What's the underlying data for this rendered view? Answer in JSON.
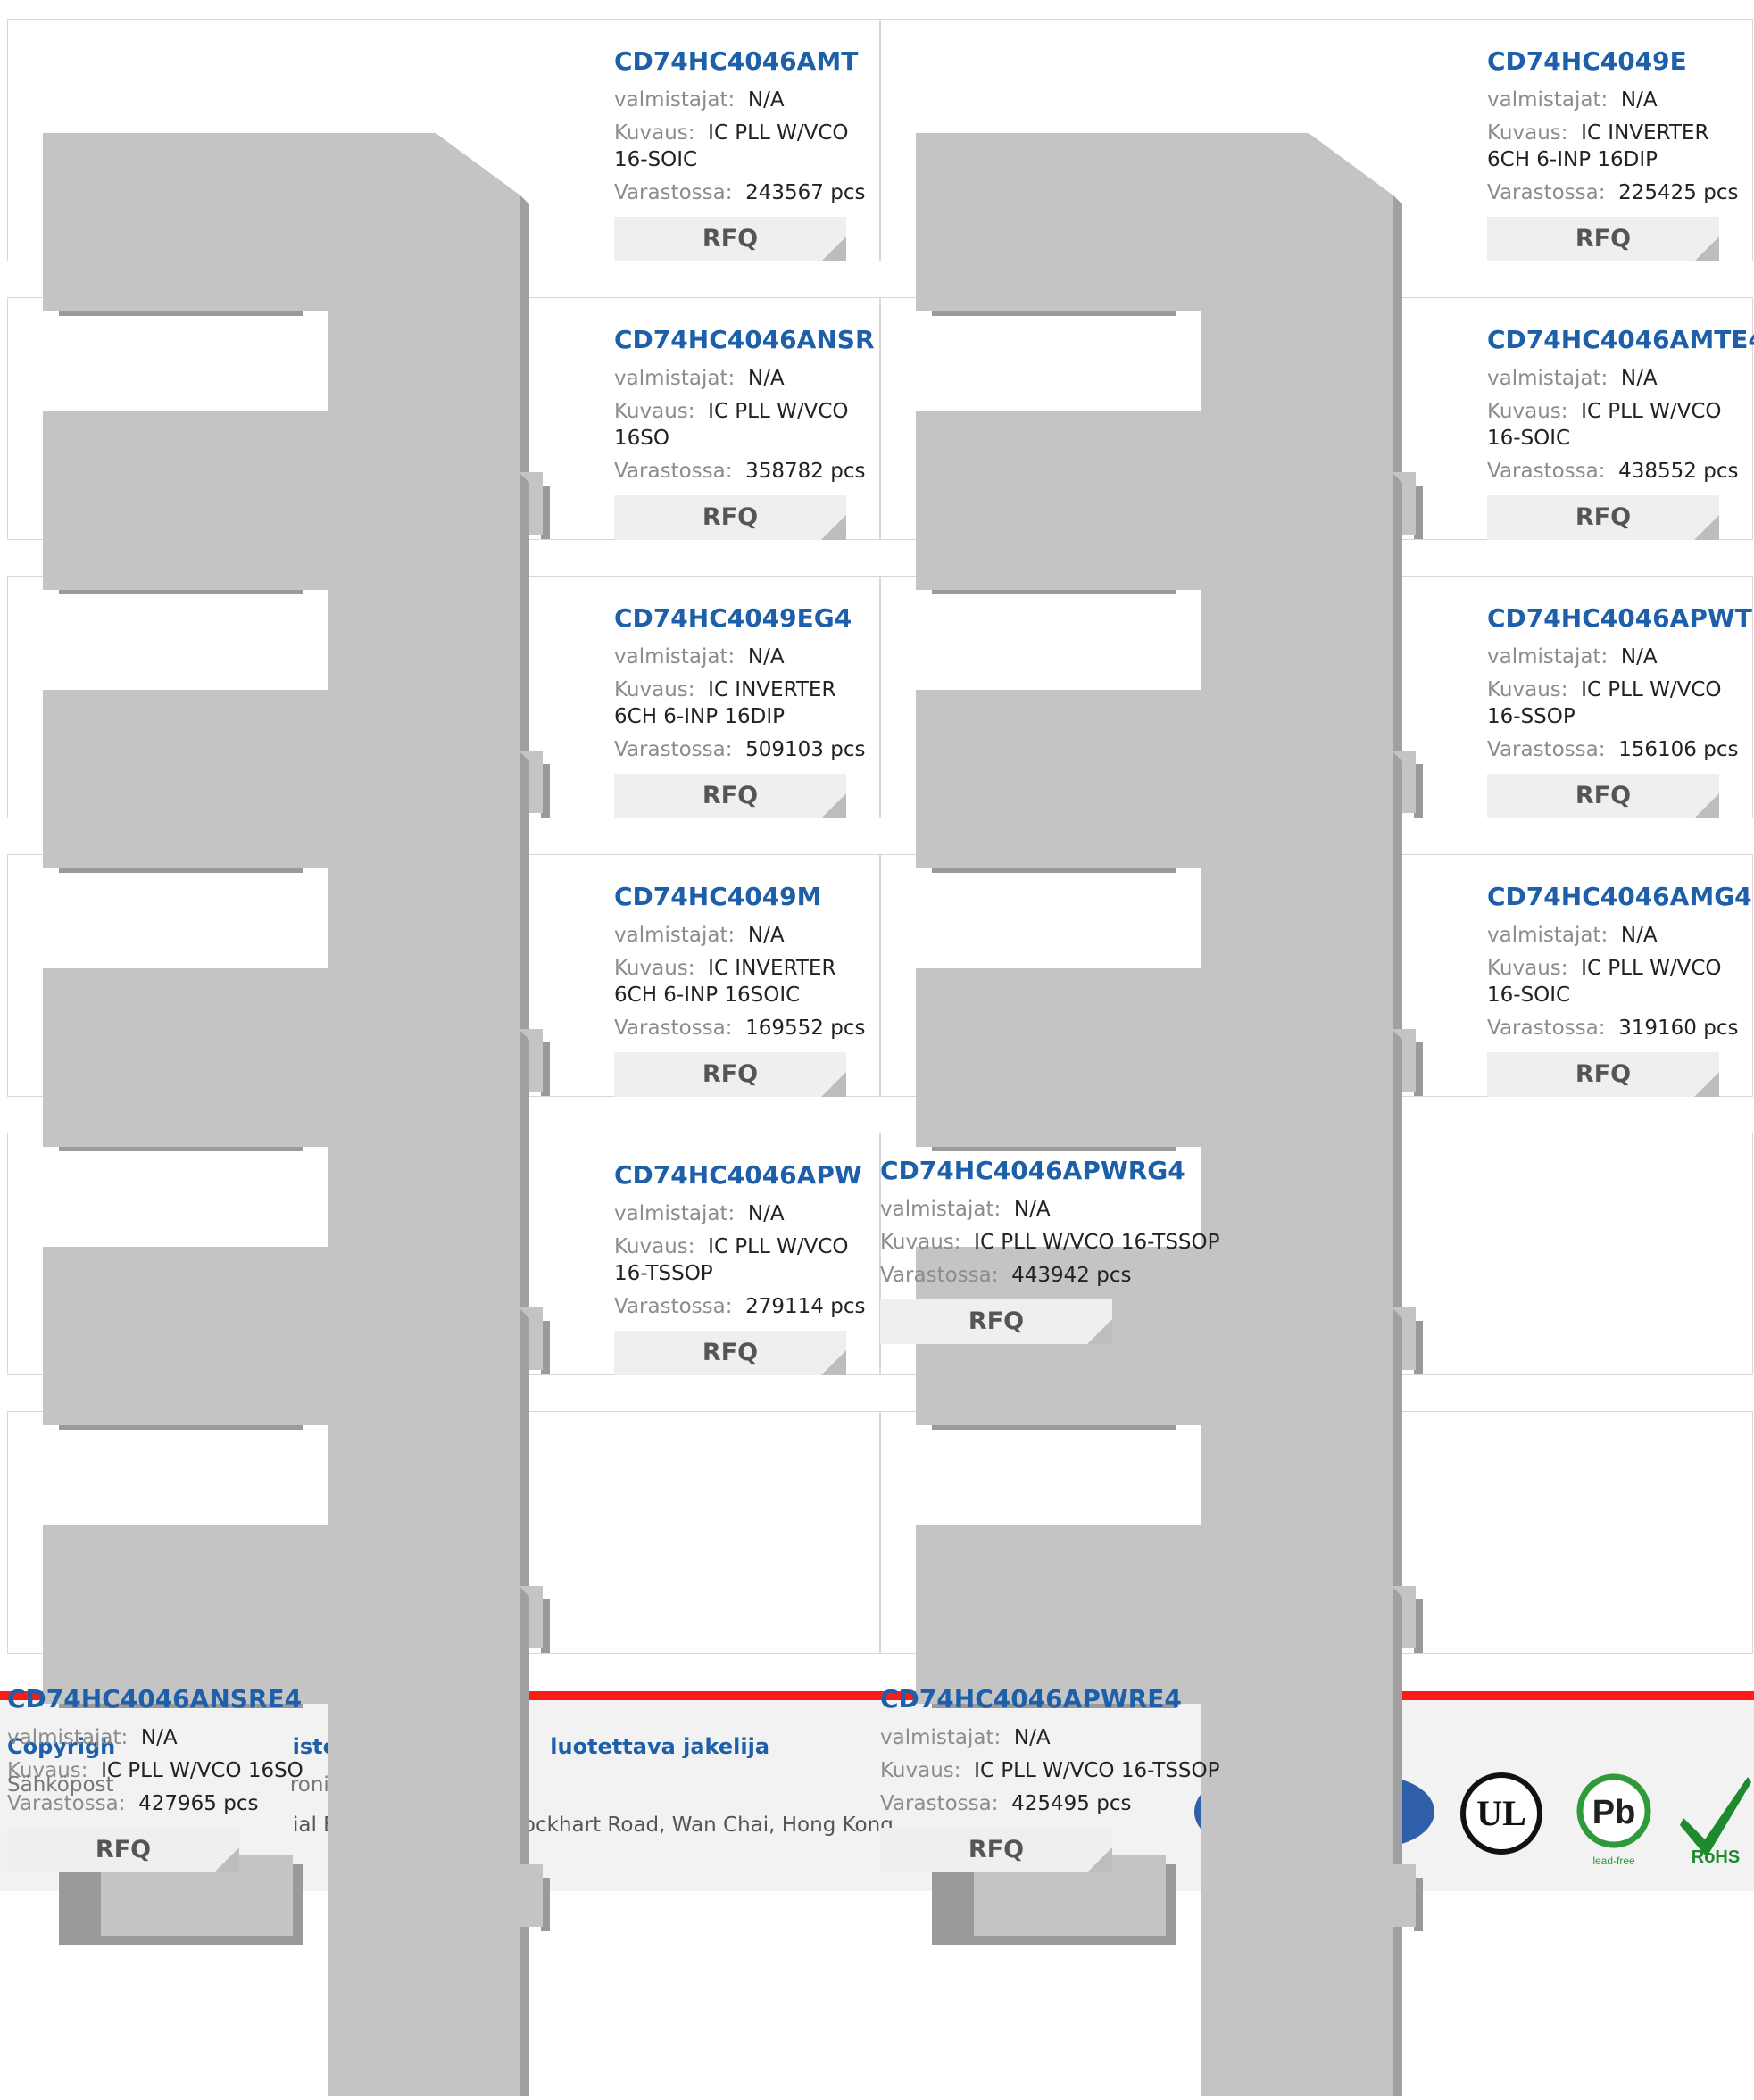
{
  "labels": {
    "manufacturer": "valmistajat:",
    "description": "Kuvaus:",
    "stock": "Varastossa:",
    "rfq": "RFQ"
  },
  "products": [
    {
      "part": "CD74HC4046AMT",
      "manufacturer": "N/A",
      "description": "IC PLL W/VCO 16-SOIC",
      "stock": "243567 pcs"
    },
    {
      "part": "CD74HC4049E",
      "manufacturer": "N/A",
      "description": "IC INVERTER 6CH 6-INP 16DIP",
      "stock": "225425 pcs"
    },
    {
      "part": "CD74HC4046ANSR",
      "manufacturer": "N/A",
      "description": "IC PLL W/VCO 16SO",
      "stock": "358782 pcs"
    },
    {
      "part": "CD74HC4046AMTE4",
      "manufacturer": "N/A",
      "description": "IC PLL W/VCO 16-SOIC",
      "stock": "438552 pcs"
    },
    {
      "part": "CD74HC4049EG4",
      "manufacturer": "N/A",
      "description": "IC INVERTER 6CH 6-INP 16DIP",
      "stock": "509103 pcs"
    },
    {
      "part": "CD74HC4046APWT",
      "manufacturer": "N/A",
      "description": "IC PLL W/VCO 16-SSOP",
      "stock": "156106 pcs"
    },
    {
      "part": "CD74HC4049M",
      "manufacturer": "N/A",
      "description": "IC INVERTER 6CH 6-INP 16SOIC",
      "stock": "169552 pcs"
    },
    {
      "part": "CD74HC4046AMG4",
      "manufacturer": "N/A",
      "description": "IC PLL W/VCO 16-SOIC",
      "stock": "319160 pcs"
    },
    {
      "part": "CD74HC4046APW",
      "manufacturer": "N/A",
      "description": "IC PLL W/VCO 16-TSSOP",
      "stock": "279114 pcs"
    },
    {
      "part": "CD74HC4046APWRG4",
      "manufacturer": "N/A",
      "description": "IC PLL W/VCO 16-TSSOP",
      "stock": "443942 pcs"
    },
    {
      "part": "CD74HC4046ANSRE4",
      "manufacturer": "N/A",
      "description": "IC PLL W/VCO 16SO",
      "stock": "427965 pcs"
    },
    {
      "part": "CD74HC4046APWRE4",
      "manufacturer": "N/A",
      "description": "IC PLL W/VCO 16-TSSOP",
      "stock": "425495 pcs"
    }
  ],
  "footer": {
    "copyright": "Copyrigh",
    "tagline_mid": "iste",
    "tagline_end": "luotettava jakelija",
    "email_label": "Sähköpost",
    "email_rest": "roni",
    "address": "ial Building, 114-118 Lockhart Road, Wan Chai, Hong Kong",
    "badge_ul": "UL",
    "badge_pb": "Pb",
    "badge_lead_free": "lead-free",
    "badge_rohs": "RoHS"
  },
  "colors": {
    "title": "#1d5fa8",
    "footer_bar": "#ff1a1a",
    "chip": "#c4c4c4"
  }
}
